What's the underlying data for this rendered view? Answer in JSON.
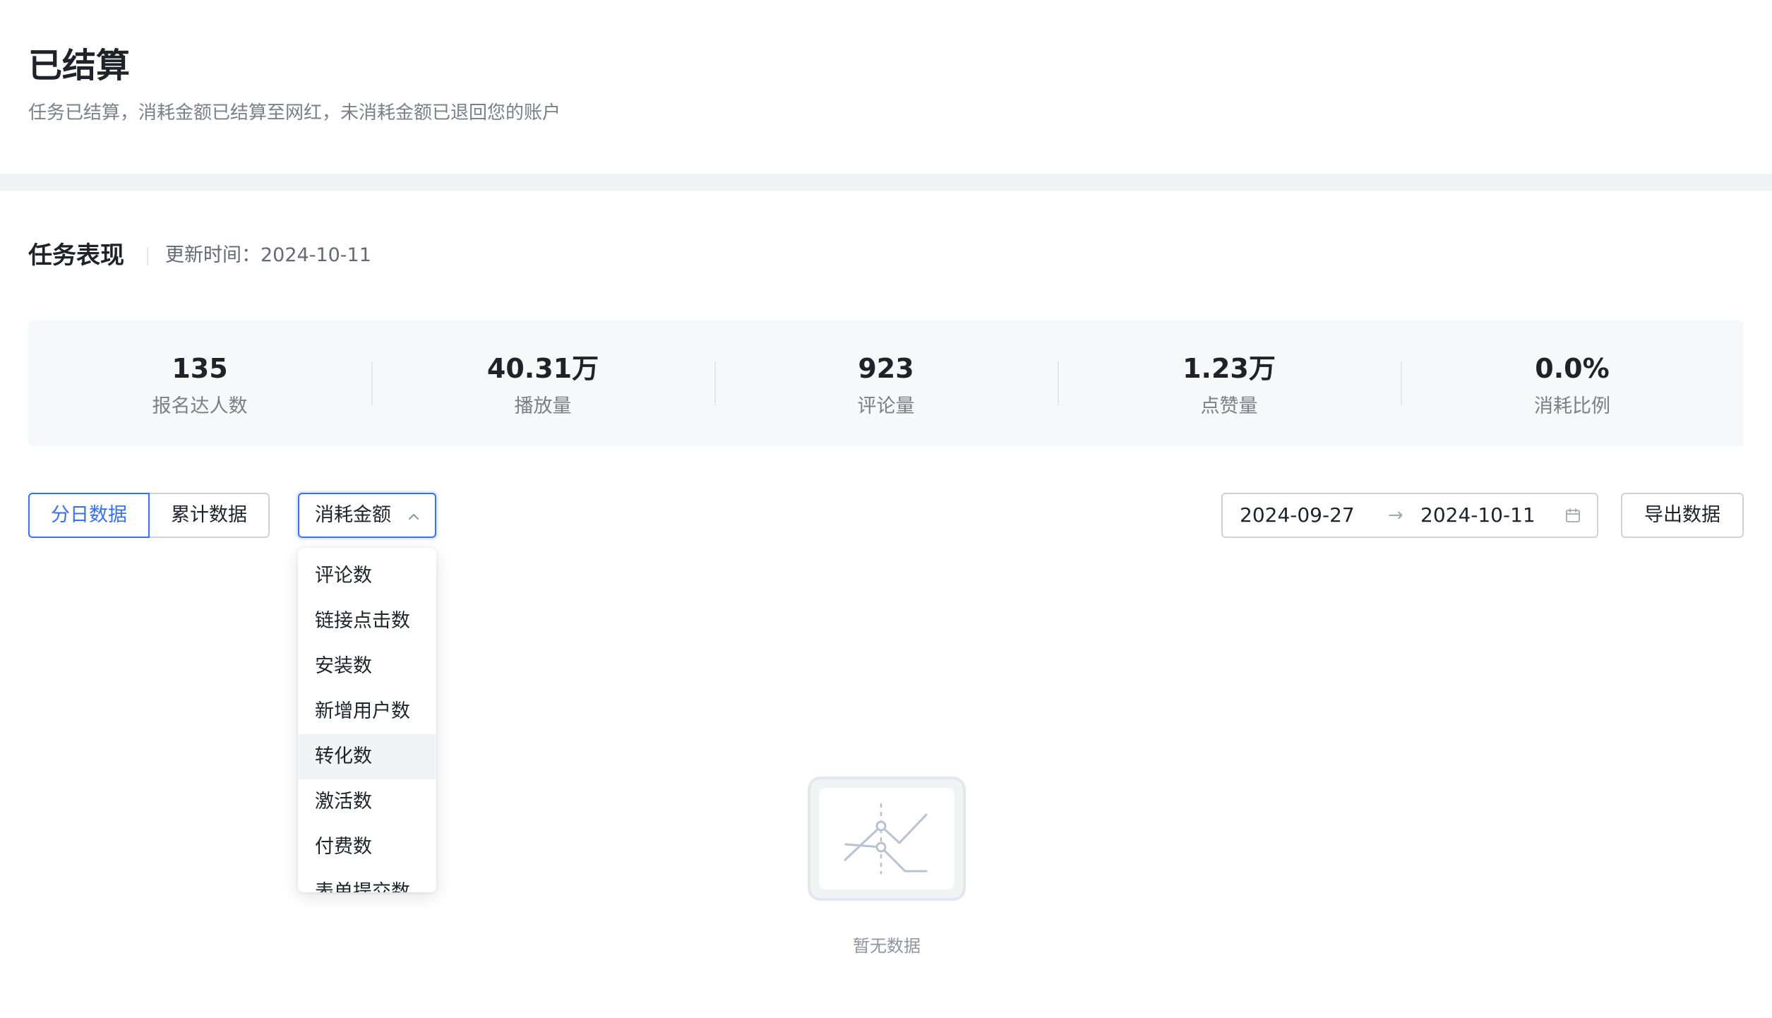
{
  "header": {
    "title": "已结算",
    "subtitle": "任务已结算，消耗金额已结算至网红，未消耗金额已退回您的账户"
  },
  "performance": {
    "title": "任务表现",
    "update_time": "更新时间：2024-10-11"
  },
  "stats": [
    {
      "value": "135",
      "label": "报名达人数"
    },
    {
      "value": "40.31万",
      "label": "播放量"
    },
    {
      "value": "923",
      "label": "评论量"
    },
    {
      "value": "1.23万",
      "label": "点赞量"
    },
    {
      "value": "0.0%",
      "label": "消耗比例"
    }
  ],
  "toolbar": {
    "daily_label": "分日数据",
    "cumulative_label": "累计数据",
    "metric_selected": "消耗金额",
    "metric_options": [
      "评论数",
      "链接点击数",
      "安装数",
      "新增用户数",
      "转化数",
      "激活数",
      "付费数",
      "表单提交数"
    ],
    "hovered_option": "转化数",
    "date_start": "2024-09-27",
    "date_separator": "→",
    "date_end": "2024-10-11",
    "export_label": "导出数据"
  },
  "empty": {
    "text": "暂无数据"
  },
  "colors": {
    "accent": "#3370ff",
    "panel_bg": "#f7f8fa",
    "band_bg": "#f2f3f5"
  }
}
